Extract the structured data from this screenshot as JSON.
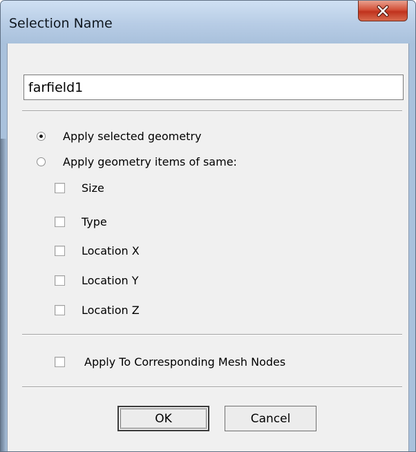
{
  "window": {
    "title": "Selection Name",
    "close_icon": "close-x-icon"
  },
  "name_field": {
    "value": "farfield1"
  },
  "options": {
    "radio_selected_geometry": {
      "label": "Apply selected geometry",
      "checked": true
    },
    "radio_same_items": {
      "label": "Apply geometry items of same:",
      "checked": false
    },
    "checkboxes": [
      {
        "label": "Size",
        "checked": false
      },
      {
        "label": "Type",
        "checked": false
      },
      {
        "label": "Location X",
        "checked": false
      },
      {
        "label": "Location Y",
        "checked": false
      },
      {
        "label": "Location Z",
        "checked": false
      }
    ],
    "mesh_nodes": {
      "label": "Apply To Corresponding Mesh Nodes",
      "checked": false
    }
  },
  "buttons": {
    "ok": "OK",
    "cancel": "Cancel"
  }
}
